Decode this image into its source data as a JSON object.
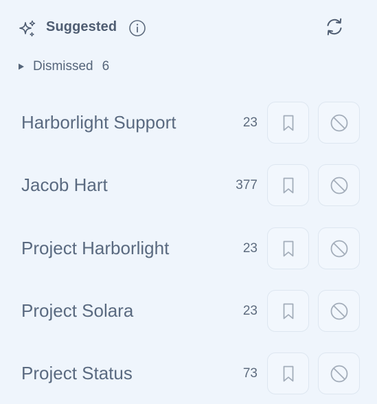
{
  "header": {
    "title": "Suggested",
    "icons": {
      "sparkle": "sparkles-icon",
      "info": "info-icon",
      "refresh": "refresh-icon"
    }
  },
  "dismissed": {
    "label": "Dismissed",
    "count": "6"
  },
  "items": [
    {
      "name": "Harborlight Support",
      "count": "23"
    },
    {
      "name": "Jacob Hart",
      "count": "377"
    },
    {
      "name": "Project Harborlight",
      "count": "23"
    },
    {
      "name": "Project Solara",
      "count": "23"
    },
    {
      "name": "Project Status",
      "count": "73"
    }
  ],
  "colors": {
    "background": "#eff5fc",
    "text": "#5a6a80",
    "button_border": "#dde6f0",
    "icon": "#a3adba"
  }
}
